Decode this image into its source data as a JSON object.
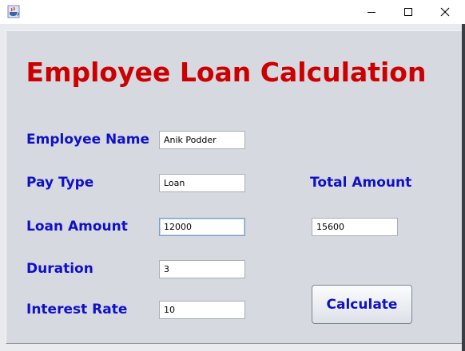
{
  "window": {
    "icon": "java-coffee-cup-icon",
    "controls": {
      "minimize_icon": "minimize-icon",
      "maximize_icon": "maximize-icon",
      "close_icon": "close-icon"
    }
  },
  "form": {
    "title": "Employee Loan Calculation",
    "fields": {
      "employee_name": {
        "label": "Employee Name",
        "value": "Anik Podder"
      },
      "pay_type": {
        "label": "Pay Type",
        "value": "Loan"
      },
      "loan_amount": {
        "label": "Loan Amount",
        "value": "12000"
      },
      "duration": {
        "label": "Duration",
        "value": "3"
      },
      "interest_rate": {
        "label": "Interest Rate",
        "value": "10"
      },
      "total_amount": {
        "label": "Total Amount",
        "value": "15600"
      }
    },
    "calculate_label": "Calculate"
  },
  "colors": {
    "title": "#cc0000",
    "label": "#1010c8",
    "panel": "#d6d9e0"
  }
}
